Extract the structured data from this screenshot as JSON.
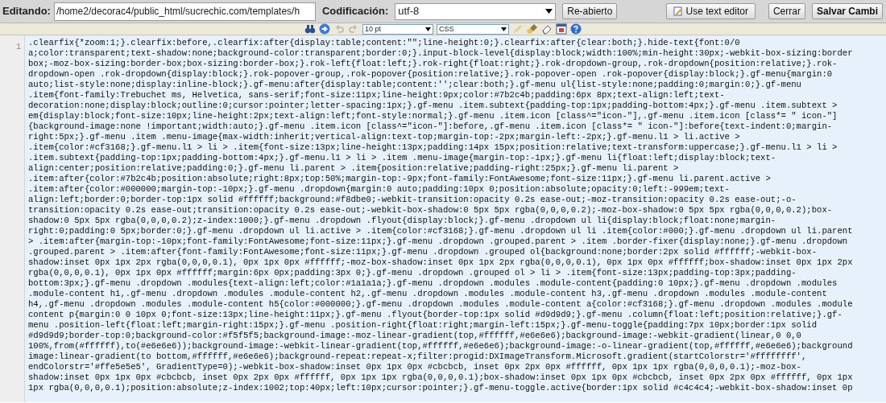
{
  "header": {
    "editing_label": "Editando:",
    "path": "/home2/decorac4/public_html/sucrechic.com/templates/h",
    "encoding_label": "Codificación:",
    "encoding": "utf-8",
    "reopen_button": "Re-abierto",
    "text_editor_button": "Use text editor",
    "close_button": "Cerrar",
    "save_button": "Salvar Cambi"
  },
  "toolbar": {
    "tools_left": [
      {
        "kind": "find",
        "disabled": false
      },
      {
        "kind": "goto",
        "disabled": false
      },
      {
        "kind": "undo",
        "disabled": true
      },
      {
        "kind": "redo",
        "disabled": true
      }
    ],
    "font_size": "10 pt",
    "language": "CSS",
    "tools_right": [
      {
        "kind": "wrap",
        "disabled": true
      },
      {
        "kind": "highlight",
        "disabled": false
      },
      {
        "kind": "reset",
        "disabled": false
      },
      {
        "kind": "fullscreen",
        "disabled": false
      },
      {
        "kind": "help",
        "disabled": false
      }
    ]
  },
  "editor": {
    "line_number": "1",
    "lines": [
      ".clearfix{*zoom:1;}.clearfix:before,.clearfix:after{display:table;content:\"\";line-height:0;}.clearfix:after{clear:both;}.hide-text{font:0/0",
      "a;color:transparent;text-shadow:none;background-color:transparent;border:0;}.input-block-level{display:block;width:100%;min-height:30px;-webkit-box-sizing:border",
      "box;-moz-box-sizing:border-box;box-sizing:border-box;}.rok-left{float:left;}.rok-right{float:right;}.rok-dropdown-group,.rok-dropdown{position:relative;}.rok-",
      "dropdown-open .rok-dropdown{display:block;}.rok-popover-group,.rok-popover{position:relative;}.rok-popover-open .rok-popover{display:block;}.gf-menu{margin:0",
      "auto;list-style:none;display:inline-block;}.gf-menu:after{display:table;content:'';clear:both;}.gf-menu ul{list-style:none;padding:0;margin:0;}.gf-menu",
      ".item{font-family:Trebuchet ms, Helvetica, sans-serif;font-size:11px;line-height:9px;color:#7b2c4b;padding:6px 8px;text-align:left;text-",
      "decoration:none;display:block;outline:0;cursor:pointer;letter-spacing:1px;}.gf-menu .item.subtext{padding-top:1px;padding-bottom:4px;}.gf-menu .item.subtext >",
      "em{display:block;font-size:10px;line-height:2px;text-align:left;font-style:normal;}.gf-menu .item.icon [class^=\"icon-\"],.gf-menu .item.icon [class*= \" icon-\"]",
      "{background-image:none !important;width:auto;}.gf-menu .item.icon [class^=\"icon-\"]:before,.gf-menu .item.icon [class*= \" icon-\"]:before{text-indent:0;margin-",
      "right:5px;}.gf-menu .item .menu-image{max-width:inherit;vertical-align:text-top;margin-top:-2px;margin-left:-2px;}.gf-menu.l1 > li.active >",
      ".item{color:#cf3168;}.gf-menu.l1 > li > .item{font-size:13px;line-height:13px;padding:14px 15px;position:relative;text-transform:uppercase;}.gf-menu.l1 > li >",
      ".item.subtext{padding-top:1px;padding-bottom:4px;}.gf-menu.l1 > li > .item .menu-image{margin-top:-1px;}.gf-menu li{float:left;display:block;text-",
      "align:center;position:relative;padding:0;}.gf-menu li.parent > .item{position:relative;padding-right:25px;}.gf-menu li.parent >",
      ".item:after{color:#7b2c4b;position:absolute;right:8px;top:50%;margin-top:-9px;font-family:FontAwesome;font-size:11px;}.gf-menu li.parent.active >",
      ".item:after{color:#000000;margin-top:-10px;}.gf-menu .dropdown{margin:0 auto;padding:10px 0;position:absolute;opacity:0;left:-999em;text-",
      "align:left;border:0;border-top:1px solid #ffffff;background:#f8dbe0;-webkit-transition:opacity 0.2s ease-out;-moz-transition:opacity 0.2s ease-out;-o-",
      "transition:opacity 0.2s ease-out;transition:opacity 0.2s ease-out;-webkit-box-shadow:0 5px 5px rgba(0,0,0,0.2);-moz-box-shadow:0 5px 5px rgba(0,0,0,0.2);box-",
      "shadow:0 5px 5px rgba(0,0,0,0.2);z-index:1000;}.gf-menu .dropdown .flyout{display:block;}.gf-menu .dropdown ul li{display:block;float:none;margin-",
      "right:0;padding:0 5px;border:0;}.gf-menu .dropdown ul li.active > .item{color:#cf3168;}.gf-menu .dropdown ul li .item{color:#000;}.gf-menu .dropdown ul li.parent",
      "> .item:after{margin-top:-10px;font-family:FontAwesome;font-size:11px;}.gf-menu .dropdown .grouped.parent > .item .border-fixer{display:none;}.gf-menu .dropdown",
      ".grouped.parent > .item:after{font-family:FontAwesome;font-size:11px;}.gf-menu .dropdown .grouped ol{background:none;border:2px solid #ffffff;-webkit-box-",
      "shadow:inset 0px 1px 2px rgba(0,0,0,0.1), 0px 1px 0px #ffffff;-moz-box-shadow:inset 0px 1px 2px rgba(0,0,0,0.1), 0px 1px 0px #ffffff;box-shadow:inset 0px 1px 2px",
      "rgba(0,0,0,0.1), 0px 1px 0px #ffffff;margin:6px 0px;padding:3px 0;}.gf-menu .dropdown .grouped ol > li > .item{font-size:13px;padding-top:3px;padding-",
      "bottom:3px;}.gf-menu .dropdown .modules{text-align:left;color:#1a1a1a;}.gf-menu .dropdown .modules .module-content{padding:0 10px;}.gf-menu .dropdown .modules",
      ".module-content h1,.gf-menu .dropdown .modules .module-content h2,.gf-menu .dropdown .modules .module-content h3,.gf-menu .dropdown .modules .module-content",
      "h4,.gf-menu .dropdown .modules .module-content h5{color:#000000;}.gf-menu .dropdown .modules .module-content a{color:#cf3168;}.gf-menu .dropdown .modules .module",
      "content p{margin:0 0 10px 0;font-size:13px;line-height:11px;}.gf-menu .flyout{border-top:1px solid #d9d9d9;}.gf-menu .column{float:left;position:relative;}.gf-",
      "menu .position-left{float:left;margin-right:15px;}.gf-menu .position-right{float:right;margin-left:15px;}.gf-menu-toggle{padding:7px 10px;border:1px solid",
      "#d9d9d9;border-top:0;background-color:#f5f5f5;background-image:-moz-linear-gradient(top,#ffffff,#e6e6e6);background-image:-webkit-gradient(linear,0 0,0",
      "100%,from(#ffffff),to(#e6e6e6));background-image:-webkit-linear-gradient(top,#ffffff,#e6e6e6);background-image:-o-linear-gradient(top,#ffffff,#e6e6e6);background",
      "image:linear-gradient(to bottom,#ffffff,#e6e6e6);background-repeat:repeat-x;filter:progid:DXImageTransform.Microsoft.gradient(startColorstr='#ffffffff',",
      "endColorstr='#ffe5e5e5', GradientType=0);-webkit-box-shadow:inset 0px 1px 0px #cbcbcb, inset 0px 2px 0px #ffffff, 0px 1px 1px rgba(0,0,0,0.1);-moz-box-",
      "shadow:inset 0px 1px 0px #cbcbcb, inset 0px 2px 0px #ffffff, 0px 1px 1px rgba(0,0,0,0.1);box-shadow:inset 0px 1px 0px #cbcbcb, inset 0px 2px 0px #ffffff, 0px 1px",
      "1px rgba(0,0,0,0.1);position:absolute;z-index:1002;top:40px;left:10px;cursor:pointer;}.gf-menu-toggle.active{border:1px solid #c4c4c4;-webkit-box-shadow:inset 0p"
    ]
  }
}
